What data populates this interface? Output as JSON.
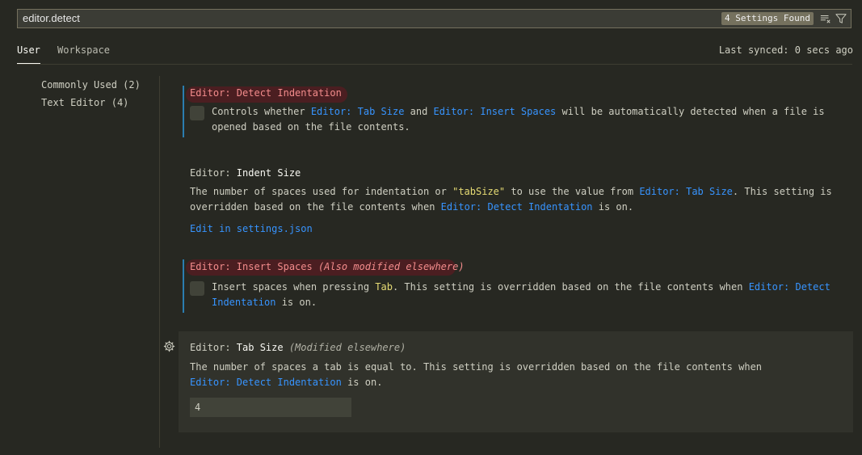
{
  "search": {
    "value": "editor.detect",
    "result_count": "4 Settings Found",
    "clear_icon": "clear-filter-icon",
    "filter_icon": "filter-icon"
  },
  "tabs": [
    {
      "label": "User",
      "active": true
    },
    {
      "label": "Workspace",
      "active": false
    }
  ],
  "sync_status": "Last synced: 0 secs ago",
  "toc": [
    {
      "label": "Commonly Used",
      "count": "(2)"
    },
    {
      "label": "Text Editor",
      "count": "(4)"
    }
  ],
  "settings": {
    "detect_indentation": {
      "category": "Editor: ",
      "label": "Detect Indentation",
      "desc": {
        "p1": "Controls whether ",
        "link1": "Editor: Tab Size",
        "p2": " and ",
        "link2": "Editor: Insert Spaces",
        "p3": " will be automatically detected when a file is opened based on the file contents."
      },
      "checked": false
    },
    "indent_size": {
      "category": "Editor: ",
      "label": "Indent Size",
      "desc": {
        "p1": "The number of spaces used for indentation or ",
        "code": "\"tabSize\"",
        "p2": " to use the value from ",
        "link1": "Editor: Tab Size",
        "p3": ". This setting is overridden based on the file contents when ",
        "link2": "Editor: Detect Indentation",
        "p4": " is on."
      },
      "edit_link": "Edit in settings.json"
    },
    "insert_spaces": {
      "category": "Editor: ",
      "label": "Insert Spaces",
      "note": "(Also modified elsewhere)",
      "desc": {
        "p1": "Insert spaces when pressing ",
        "code": "Tab",
        "p2": ". This setting is overridden based on the file contents when ",
        "link1": "Editor: Detect Indentation",
        "p3": " is on."
      },
      "checked": false
    },
    "tab_size": {
      "category": "Editor: ",
      "label": "Tab Size",
      "note": "(Modified elsewhere)",
      "desc": {
        "p1": "The number of spaces a tab is equal to. This setting is overridden based on the file contents when ",
        "link1": "Editor: Detect Indentation",
        "p2": " is on."
      },
      "value": "4",
      "gear_icon": "gear-icon"
    }
  },
  "colors": {
    "background": "#272822",
    "link": "#3794ff",
    "modified_indicator": "#2b7db0",
    "search_highlight_text": "#f38c8c",
    "code": "#e6db74"
  }
}
